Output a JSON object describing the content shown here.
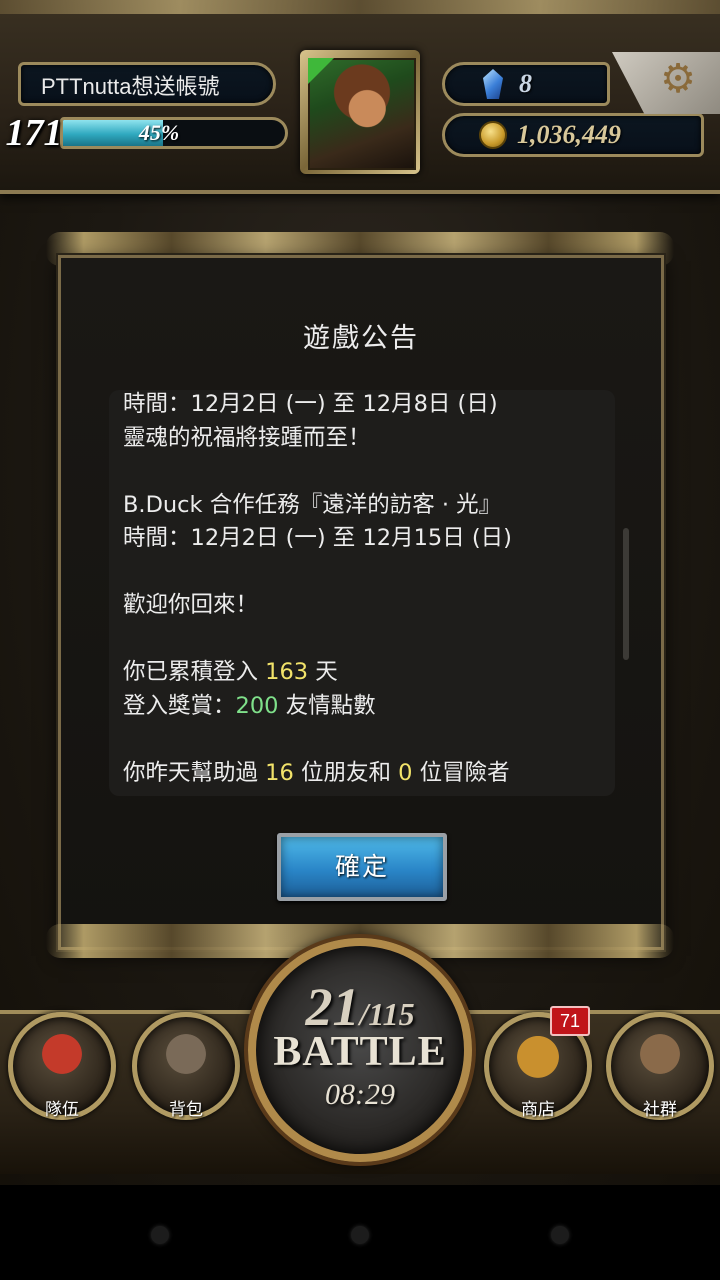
{
  "player": {
    "name": "PTTnutta想送帳號",
    "level": "171",
    "xp_percent_label": "45%",
    "xp_fraction": 0.45
  },
  "currency": {
    "gems": "8",
    "coins": "1,036,449"
  },
  "icons": {
    "gem": "diamond-icon",
    "coin": "coin-icon",
    "settings": "gear-icon",
    "team": "flag-icon",
    "bag": "backpack-icon",
    "shop": "treasure-chest-icon",
    "social": "people-icon"
  },
  "dialog": {
    "title": "遊戲公告",
    "confirm_label": "確定",
    "lines": [
      [
        {
          "t": "時間：12月2日 (一) 至 12月8日 (日)"
        }
      ],
      [
        {
          "t": "靈魂的祝福將接踵而至！"
        }
      ],
      [
        {
          "t": ""
        }
      ],
      [
        {
          "t": "B.Duck 合作任務『遠洋的訪客 · 光』"
        }
      ],
      [
        {
          "t": "時間：12月2日 (一) 至 12月15日 (日)"
        }
      ],
      [
        {
          "t": ""
        }
      ],
      [
        {
          "t": "歡迎你回來！"
        }
      ],
      [
        {
          "t": ""
        }
      ],
      [
        {
          "t": "你已累積登入 "
        },
        {
          "t": "163",
          "c": "yellow"
        },
        {
          "t": " 天"
        }
      ],
      [
        {
          "t": "登入獎賞："
        },
        {
          "t": "200",
          "c": "green"
        },
        {
          "t": " 友情點數"
        }
      ],
      [
        {
          "t": ""
        }
      ],
      [
        {
          "t": "你昨天幫助過 "
        },
        {
          "t": "16",
          "c": "yellow"
        },
        {
          "t": " 位朋友和 "
        },
        {
          "t": "0",
          "c": "yellow"
        },
        {
          "t": " 位冒險者"
        }
      ]
    ]
  },
  "bottom_nav": {
    "team_label": "隊伍",
    "bag_label": "背包",
    "shop_label": "商店",
    "shop_badge": "71",
    "social_label": "社群"
  },
  "battle": {
    "stamina_current": "21",
    "stamina_max": "/115",
    "label": "BATTLE",
    "timer": "08:29"
  },
  "colors": {
    "highlight_yellow": "#f2e36a",
    "highlight_green": "#7fe08a",
    "xp_bar": "#2fa9bf",
    "confirm_button": "#2a86c8",
    "badge_red": "#c0141a"
  }
}
